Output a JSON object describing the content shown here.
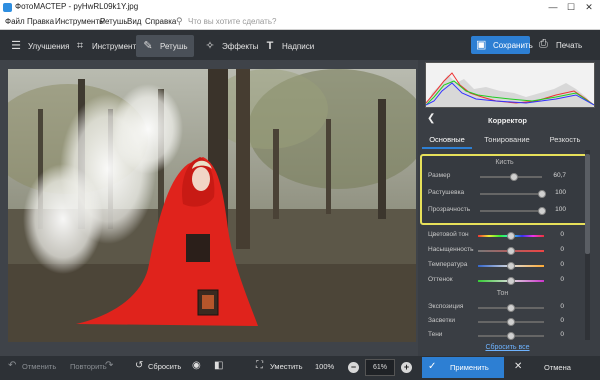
{
  "window": {
    "title": "ФотоМАСТЕР - pyHwRL09k1Y.jpg",
    "minimize": "—",
    "maximize": "☐",
    "close": "✕"
  },
  "menu": {
    "items": [
      "Файл",
      "Правка",
      "Инструменты",
      "Ретушь",
      "Вид",
      "Справка"
    ],
    "search_placeholder": "Что вы хотите сделать?"
  },
  "toolbar": {
    "tabs": [
      {
        "label": "Улучшения",
        "icon": "sliders-icon"
      },
      {
        "label": "Инструменты",
        "icon": "crop-icon"
      },
      {
        "label": "Ретушь",
        "icon": "brush-icon",
        "active": true
      },
      {
        "label": "Эффекты",
        "icon": "magic-wand-icon"
      },
      {
        "label": "Надписи",
        "icon": "text-icon"
      }
    ],
    "save_label": "Сохранить",
    "print_label": "Печать"
  },
  "panel": {
    "title": "Корректор",
    "tabs": [
      "Основные",
      "Тонирование",
      "Резкость"
    ],
    "brush_section": {
      "title": "Кисть",
      "rows": [
        {
          "label": "Размер",
          "value": "60,7",
          "level": 0.55
        },
        {
          "label": "Растушевка",
          "value": "100",
          "level": 1.0
        },
        {
          "label": "Прозрачность",
          "value": "100",
          "level": 1.0
        }
      ]
    },
    "color_rows": [
      {
        "label": "Цветовой тон",
        "value": "0",
        "level": 0.5
      },
      {
        "label": "Насыщенность",
        "value": "0",
        "level": 0.5
      },
      {
        "label": "Температура",
        "value": "0",
        "level": 0.5
      },
      {
        "label": "Оттенок",
        "value": "0",
        "level": 0.5
      }
    ],
    "tone_title": "Тон",
    "tone_rows": [
      {
        "label": "Экспозиция",
        "value": "0",
        "level": 0.5
      },
      {
        "label": "Засветки",
        "value": "0",
        "level": 0.5
      },
      {
        "label": "Тени",
        "value": "0",
        "level": 0.5
      }
    ],
    "reset_all": "Сбросить все"
  },
  "bottom": {
    "undo": "Отменить",
    "redo": "Повторить",
    "reset": "Сбросить",
    "fit": "Уместить",
    "zoom_100": "100%",
    "zoom_current": "61%",
    "apply": "Применить",
    "cancel": "Отмена"
  },
  "colors": {
    "accent": "#2d7fd3",
    "highlight_border": "#e7e05a",
    "cloak": "#e0231c"
  }
}
